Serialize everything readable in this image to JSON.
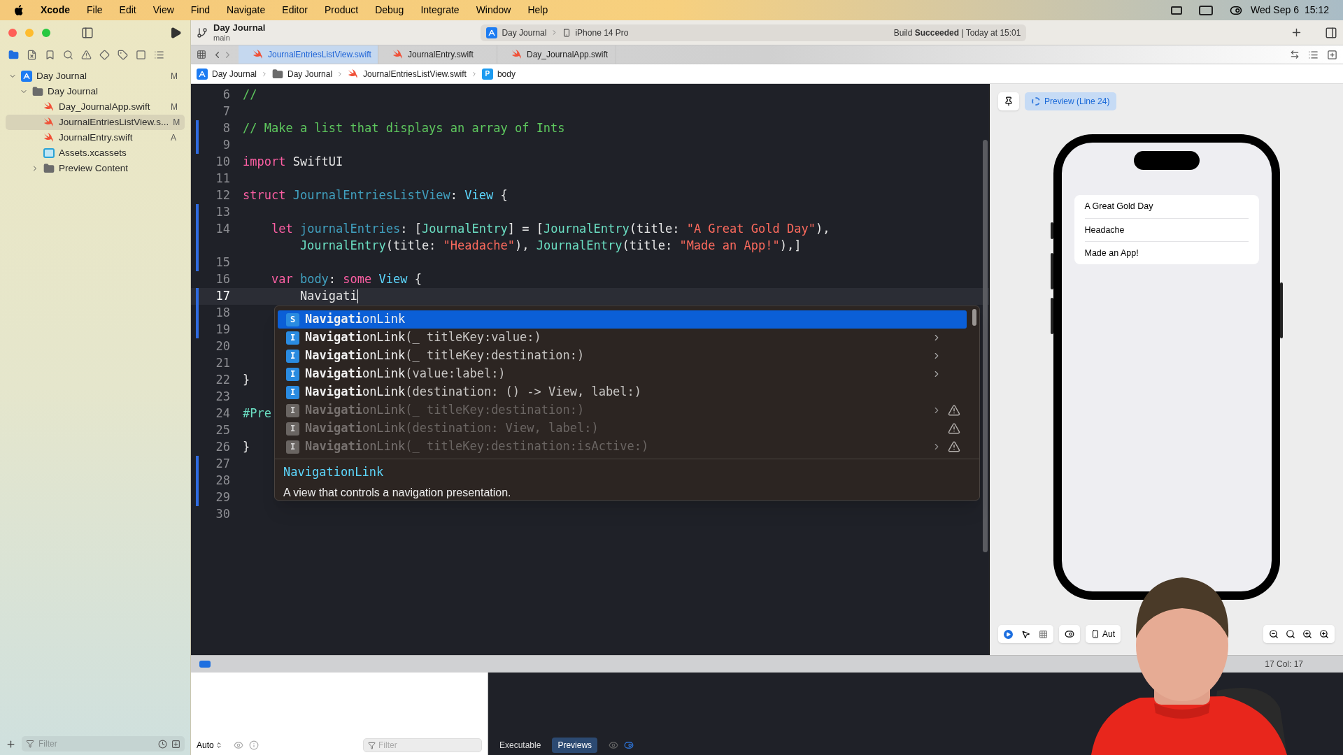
{
  "menu_bar": {
    "app": "Xcode",
    "items": [
      "File",
      "Edit",
      "View",
      "Find",
      "Navigate",
      "Editor",
      "Product",
      "Debug",
      "Integrate",
      "Window",
      "Help"
    ],
    "date": "Wed Sep 6",
    "time": "15:12"
  },
  "toolbar": {
    "project": "Day Journal",
    "branch": "main",
    "scheme": "Day Journal",
    "device": "iPhone 14 Pro",
    "status": "Build **Succeeded** | Today at 15:01"
  },
  "tabs": [
    {
      "label": "JournalEntriesListView.swift",
      "selected": true
    },
    {
      "label": "JournalEntry.swift",
      "selected": false
    },
    {
      "label": "Day_JournalApp.swift",
      "selected": false
    }
  ],
  "breadcrumb": [
    {
      "label": "Day Journal",
      "kind": "app"
    },
    {
      "label": "Day Journal",
      "kind": "folder"
    },
    {
      "label": "JournalEntriesListView.swift",
      "kind": "swift"
    },
    {
      "label": "body",
      "kind": "property",
      "icon_letter": "P"
    }
  ],
  "navigator": {
    "tree": [
      {
        "label": "Day Journal",
        "kind": "app",
        "badge": "M",
        "expanded": true,
        "selected": false,
        "children": [
          {
            "label": "Day Journal",
            "kind": "folder",
            "expanded": true,
            "selected": false,
            "children": [
              {
                "label": "Day_JournalApp.swift",
                "kind": "swift",
                "badge": "M",
                "selected": false
              },
              {
                "label": "JournalEntriesListView.s...",
                "kind": "swift",
                "badge": "M",
                "selected": true
              },
              {
                "label": "JournalEntry.swift",
                "kind": "swift",
                "badge": "A",
                "selected": false
              },
              {
                "label": "Assets.xcassets",
                "kind": "assets",
                "selected": false
              },
              {
                "label": "Preview Content",
                "kind": "folder",
                "expanded": false,
                "selected": false
              }
            ]
          }
        ]
      }
    ],
    "filter_placeholder": "Filter"
  },
  "editor": {
    "lines": [
      {
        "number": "6",
        "rows": [
          [
            {
              "kind": "comment",
              "text": "//"
            }
          ]
        ]
      },
      {
        "number": "7",
        "rows": [
          []
        ]
      },
      {
        "number": "8",
        "changed": true,
        "rows": [
          [
            {
              "kind": "comment",
              "text": "// Make a list that displays an array of Ints"
            }
          ]
        ]
      },
      {
        "number": "9",
        "changed": true,
        "rows": [
          []
        ]
      },
      {
        "number": "10",
        "rows": [
          [
            {
              "kind": "keyword",
              "text": "import"
            },
            {
              "kind": "plain",
              "text": " SwiftUI"
            }
          ]
        ]
      },
      {
        "number": "11",
        "rows": [
          []
        ]
      },
      {
        "number": "12",
        "rows": [
          [
            {
              "kind": "keyword",
              "text": "struct"
            },
            {
              "kind": "plain",
              "text": " "
            },
            {
              "kind": "decl",
              "text": "JournalEntriesListView"
            },
            {
              "kind": "plain",
              "text": ": "
            },
            {
              "kind": "type",
              "text": "View"
            },
            {
              "kind": "plain",
              "text": " {"
            }
          ]
        ]
      },
      {
        "number": "13",
        "changed": true,
        "rows": [
          []
        ]
      },
      {
        "number": "14",
        "changed": true,
        "rows": [
          [
            {
              "kind": "keyword",
              "text": "    let"
            },
            {
              "kind": "plain",
              "text": " "
            },
            {
              "kind": "decl",
              "text": "journalEntries"
            },
            {
              "kind": "plain",
              "text": ": ["
            },
            {
              "kind": "class",
              "text": "JournalEntry"
            },
            {
              "kind": "plain",
              "text": "] = ["
            },
            {
              "kind": "class",
              "text": "JournalEntry"
            },
            {
              "kind": "plain",
              "text": "(title: "
            },
            {
              "kind": "string",
              "text": "\"A Great Gold Day\""
            },
            {
              "kind": "plain",
              "text": "),"
            }
          ]
        ],
        "wrap": [
          {
            "kind": "class",
            "text": "        JournalEntry"
          },
          {
            "kind": "plain",
            "text": "(title: "
          },
          {
            "kind": "string",
            "text": "\"Headache\""
          },
          {
            "kind": "plain",
            "text": "), "
          },
          {
            "kind": "class",
            "text": "JournalEntry"
          },
          {
            "kind": "plain",
            "text": "(title: "
          },
          {
            "kind": "string",
            "text": "\"Made an App!\""
          },
          {
            "kind": "plain",
            "text": "),]"
          }
        ]
      },
      {
        "number": "15",
        "changed": true,
        "rows": [
          []
        ]
      },
      {
        "number": "16",
        "rows": [
          [
            {
              "kind": "keyword",
              "text": "    var"
            },
            {
              "kind": "plain",
              "text": " "
            },
            {
              "kind": "decl",
              "text": "body"
            },
            {
              "kind": "plain",
              "text": ": "
            },
            {
              "kind": "keyword",
              "text": "some"
            },
            {
              "kind": "plain",
              "text": " "
            },
            {
              "kind": "type",
              "text": "View"
            },
            {
              "kind": "plain",
              "text": " {"
            }
          ]
        ]
      },
      {
        "number": "17",
        "changed": true,
        "current": true,
        "rows": [
          [
            {
              "kind": "plain",
              "text": "        Navigati"
            }
          ]
        ]
      },
      {
        "number": "18",
        "changed": true,
        "rows": [
          []
        ]
      },
      {
        "number": "19",
        "changed": true,
        "rows": [
          []
        ]
      },
      {
        "number": "20",
        "rows": [
          []
        ]
      },
      {
        "number": "21",
        "rows": [
          []
        ]
      },
      {
        "number": "22",
        "rows": [
          [
            {
              "kind": "plain",
              "text": "}"
            }
          ]
        ]
      },
      {
        "number": "23",
        "rows": [
          []
        ]
      },
      {
        "number": "24",
        "rows": [
          [
            {
              "kind": "macro",
              "text": "#Pre"
            }
          ]
        ]
      },
      {
        "number": "25",
        "rows": [
          []
        ]
      },
      {
        "number": "26",
        "rows": [
          [
            {
              "kind": "plain",
              "text": "}"
            }
          ]
        ]
      },
      {
        "number": "27",
        "changed": true,
        "rows": [
          []
        ]
      },
      {
        "number": "28",
        "changed": true,
        "rows": [
          []
        ]
      },
      {
        "number": "29",
        "changed": true,
        "rows": [
          []
        ]
      },
      {
        "number": "30",
        "rows": [
          []
        ]
      }
    ]
  },
  "completions": {
    "items": [
      {
        "badge": "S",
        "match": "Navigati",
        "rest": "onLink",
        "selected": true,
        "disabled": false,
        "submenu": false,
        "warning": false
      },
      {
        "badge": "I",
        "match": "Navigati",
        "rest": "onLink",
        "params": "(_ titleKey:value:)",
        "selected": false,
        "disabled": false,
        "submenu": true,
        "warning": false
      },
      {
        "badge": "I",
        "match": "Navigati",
        "rest": "onLink",
        "params": "(_ titleKey:destination:)",
        "selected": false,
        "disabled": false,
        "submenu": true,
        "warning": false
      },
      {
        "badge": "I",
        "match": "Navigati",
        "rest": "onLink",
        "params": "(value:label:)",
        "selected": false,
        "disabled": false,
        "submenu": true,
        "warning": false
      },
      {
        "badge": "I",
        "match": "Navigati",
        "rest": "onLink",
        "params": "(destination: () -> View, label:)",
        "selected": false,
        "disabled": false,
        "submenu": false,
        "warning": false
      },
      {
        "badge": "I",
        "match": "Navigati",
        "rest": "onLink",
        "params": "(_ titleKey:destination:)",
        "selected": false,
        "disabled": true,
        "submenu": true,
        "warning": true
      },
      {
        "badge": "I",
        "match": "Navigati",
        "rest": "onLink",
        "params": "(destination: View, label:)",
        "selected": false,
        "disabled": true,
        "submenu": false,
        "warning": true
      },
      {
        "badge": "I",
        "match": "Navigati",
        "rest": "onLink",
        "params": "(_ titleKey:destination:isActive:)",
        "selected": false,
        "disabled": true,
        "submenu": true,
        "warning": true
      }
    ],
    "doc_title": "NavigationLink",
    "doc_text": "A view that controls a navigation presentation."
  },
  "preview": {
    "label": "Preview (Line 24)",
    "list": [
      "A Great Gold Day",
      "Headache",
      "Made an App!"
    ],
    "device_label": "Aut",
    "cursor_position": "17 Col: 17"
  },
  "debug_area": {
    "output_mode": "Auto",
    "filter_placeholder": "Filter",
    "tabs": [
      {
        "label": "Executable",
        "selected": false
      },
      {
        "label": "Previews",
        "selected": true
      }
    ]
  }
}
